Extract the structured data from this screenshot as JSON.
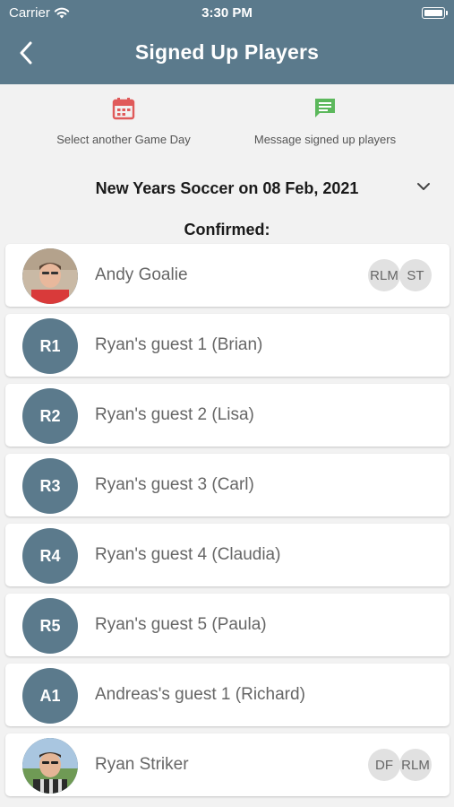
{
  "status_bar": {
    "carrier": "Carrier",
    "time": "3:30 PM"
  },
  "header": {
    "title": "Signed Up Players"
  },
  "actions": {
    "select_game_day": {
      "label": "Select another Game Day",
      "icon": "calendar-icon",
      "color": "#e05a5a"
    },
    "message_players": {
      "label": "Message signed up players",
      "icon": "message-icon",
      "color": "#5cb85c"
    }
  },
  "game": {
    "selected": "New Years Soccer on 08 Feb, 2021"
  },
  "section": {
    "title": "Confirmed:"
  },
  "players": [
    {
      "name": "Andy Goalie",
      "initials": "",
      "photo": "andy",
      "badges": [
        "RLM",
        "ST"
      ]
    },
    {
      "name": "Ryan's guest 1 (Brian)",
      "initials": "R1",
      "photo": "",
      "badges": []
    },
    {
      "name": "Ryan's guest 2 (Lisa)",
      "initials": "R2",
      "photo": "",
      "badges": []
    },
    {
      "name": "Ryan's guest 3 (Carl)",
      "initials": "R3",
      "photo": "",
      "badges": []
    },
    {
      "name": "Ryan's guest 4 (Claudia)",
      "initials": "R4",
      "photo": "",
      "badges": []
    },
    {
      "name": "Ryan's guest 5 (Paula)",
      "initials": "R5",
      "photo": "",
      "badges": []
    },
    {
      "name": "Andreas's guest 1 (Richard)",
      "initials": "A1",
      "photo": "",
      "badges": []
    },
    {
      "name": "Ryan Striker",
      "initials": "",
      "photo": "ryan",
      "badges": [
        "DF",
        "RLM"
      ]
    }
  ],
  "colors": {
    "header": "#5b7a8c",
    "avatar": "#5b7a8c",
    "badge": "#e1e1e1"
  }
}
